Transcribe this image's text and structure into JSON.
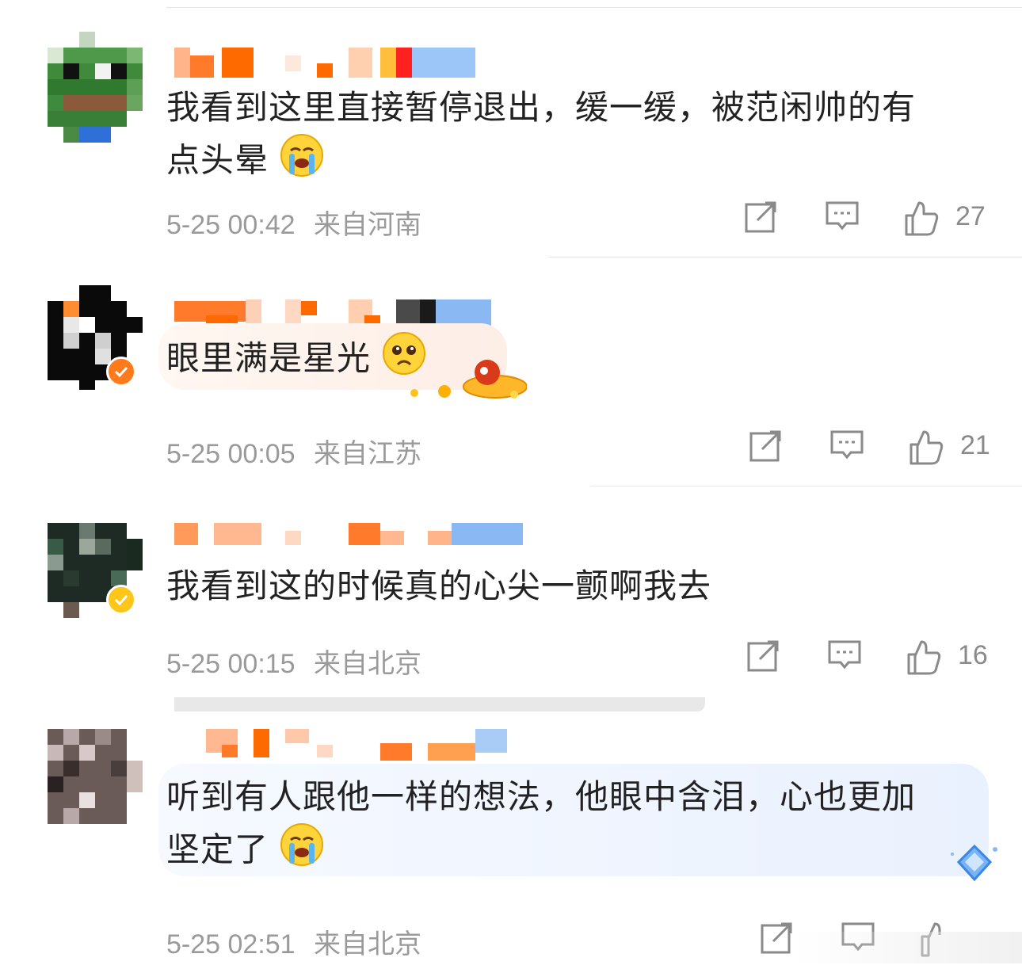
{
  "comments": [
    {
      "text_line1": "我看到这里直接暂停退出，缓一缓，被范闲帅的有",
      "text_line2": "点头晕",
      "emoji": "crying-face",
      "timestamp": "5-25 00:42",
      "location": "来自河南",
      "likes": "27"
    },
    {
      "text_line1": "眼里满是星光",
      "emoji": "pleading-face",
      "timestamp": "5-25 00:05",
      "location": "来自江苏",
      "likes": "21",
      "badge": "verified"
    },
    {
      "text_line1": "我看到这的时候真的心尖一颤啊我去",
      "timestamp": "5-25 00:15",
      "location": "来自北京",
      "likes": "16",
      "badge": "verified"
    },
    {
      "text_line1": "听到有人跟他一样的想法，他眼中含泪，心也更加",
      "text_line2": "坚定了",
      "emoji": "crying-face",
      "timestamp": "5-25 02:51",
      "location": "来自北京"
    }
  ],
  "colors": {
    "name_orange": "#ff6a00",
    "name_blue": "#82b8f5",
    "badge_orange": "#ff7a1a",
    "badge_yellow": "#ffc61a",
    "meta_gray": "#9a9a9a"
  },
  "icons": [
    "share-icon",
    "comment-icon",
    "like-icon"
  ]
}
